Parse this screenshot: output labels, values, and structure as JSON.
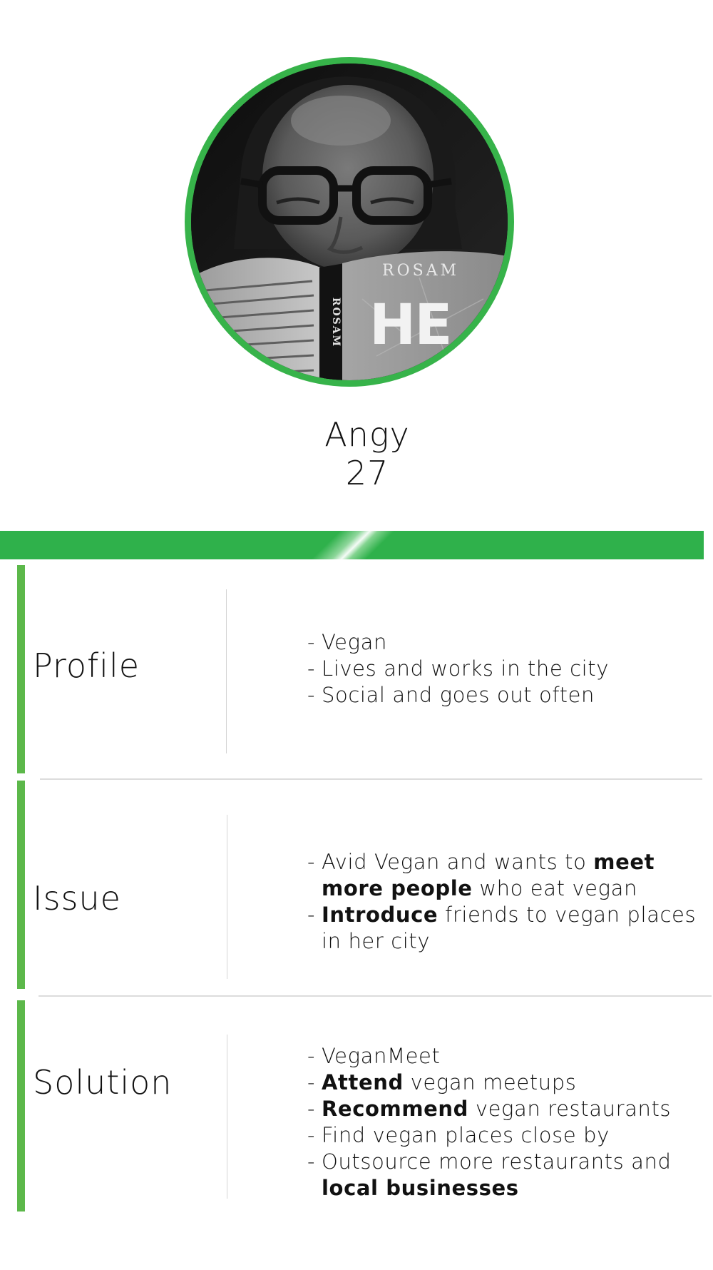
{
  "persona": {
    "name": "Angy",
    "age": "27"
  },
  "colors": {
    "accent_green": "#2fb14b",
    "section_bar_green": "#5cb84a",
    "avatar_ring_green": "#37b34a"
  },
  "avatar": {
    "icon": "person-reading-book-photo",
    "book_cover_text": "ROSAM",
    "book_spine_text": "ROSAM",
    "book_title_fragment": "HE"
  },
  "sections": [
    {
      "label": "Profile",
      "bullets": [
        {
          "parts": [
            {
              "text": "Vegan",
              "bold": false
            }
          ]
        },
        {
          "parts": [
            {
              "text": "Lives and works in the city",
              "bold": false
            }
          ]
        },
        {
          "parts": [
            {
              "text": "Social and goes out often",
              "bold": false
            }
          ]
        }
      ]
    },
    {
      "label": "Issue",
      "bullets": [
        {
          "parts": [
            {
              "text": "Avid Vegan and wants to ",
              "bold": false
            },
            {
              "text": "meet more people",
              "bold": true
            },
            {
              "text": " who eat vegan",
              "bold": false
            }
          ]
        },
        {
          "parts": [
            {
              "text": "Introduce",
              "bold": true
            },
            {
              "text": " friends to vegan places in her city",
              "bold": false
            }
          ]
        }
      ]
    },
    {
      "label": "Solution",
      "bullets": [
        {
          "parts": [
            {
              "text": "VeganMeet",
              "bold": false
            }
          ]
        },
        {
          "parts": [
            {
              "text": "Attend",
              "bold": true
            },
            {
              "text": " vegan meetups",
              "bold": false
            }
          ]
        },
        {
          "parts": [
            {
              "text": "Recommend",
              "bold": true
            },
            {
              "text": " vegan restaurants",
              "bold": false
            }
          ]
        },
        {
          "parts": [
            {
              "text": "Find vegan places close by",
              "bold": false
            }
          ]
        },
        {
          "parts": [
            {
              "text": "Outsource more restaurants and ",
              "bold": false
            },
            {
              "text": "local businesses",
              "bold": true
            }
          ]
        }
      ]
    }
  ]
}
